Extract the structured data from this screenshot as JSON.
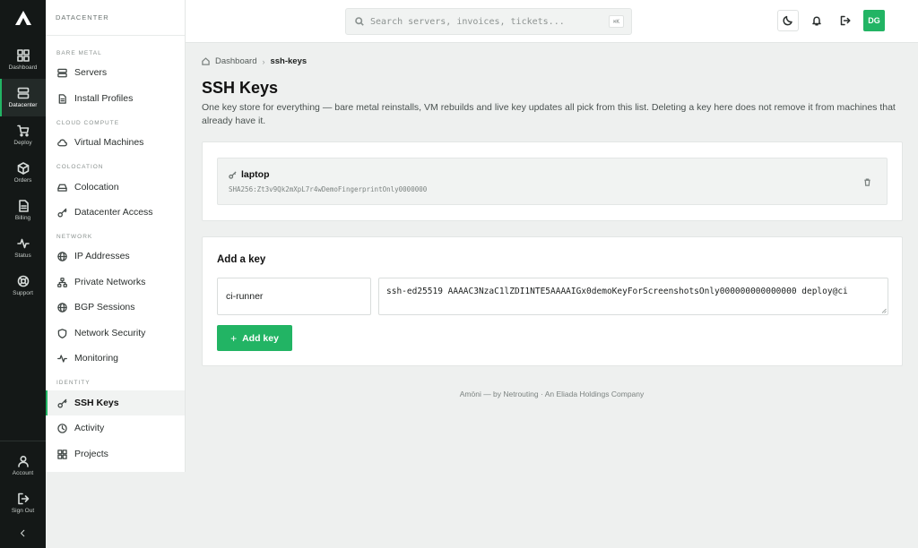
{
  "rail": {
    "items": [
      {
        "label": "Dashboard",
        "icon": "grid-icon"
      },
      {
        "label": "Datacenter",
        "icon": "server-icon",
        "active": true
      },
      {
        "label": "Deploy",
        "icon": "cart-icon"
      },
      {
        "label": "Orders",
        "icon": "box-icon"
      },
      {
        "label": "Billing",
        "icon": "document-icon"
      },
      {
        "label": "Status",
        "icon": "pulse-icon"
      },
      {
        "label": "Support",
        "icon": "lifebuoy-icon"
      }
    ],
    "bottom": [
      {
        "label": "Account",
        "icon": "user-icon"
      },
      {
        "label": "Sign Out",
        "icon": "logout-icon"
      }
    ],
    "collapse_icon": "chevron-left-icon"
  },
  "sidebar": {
    "header": "DATACENTER",
    "sections": {
      "bare_metal": "BARE METAL",
      "cloud_compute": "CLOUD COMPUTE",
      "colocation": "COLOCATION",
      "network": "NETWORK",
      "identity": "IDENTITY"
    },
    "items": {
      "servers": "Servers",
      "install_profiles": "Install Profiles",
      "virtual_machines": "Virtual Machines",
      "colocation": "Colocation",
      "datacenter_access": "Datacenter Access",
      "ip_addresses": "IP Addresses",
      "private_networks": "Private Networks",
      "bgp_sessions": "BGP Sessions",
      "network_security": "Network Security",
      "monitoring": "Monitoring",
      "ssh_keys": "SSH Keys",
      "activity": "Activity",
      "projects": "Projects"
    }
  },
  "topbar": {
    "search_placeholder": "Search servers, invoices, tickets...",
    "search_shortcut": "⌘K",
    "avatar_initials": "DG"
  },
  "breadcrumb": {
    "home": "Dashboard",
    "current": "ssh-keys"
  },
  "page": {
    "title": "SSH Keys",
    "description": "One key store for everything — bare metal reinstalls, VM rebuilds and live key updates all pick from this list. Deleting a key here does not remove it from machines that already have it."
  },
  "keys": [
    {
      "name": "laptop",
      "fingerprint": "SHA256:Zt3v9Qk2mXpL7r4wDemoFingerprintOnly0000000"
    }
  ],
  "add_key": {
    "title": "Add a key",
    "name_value": "ci-runner",
    "key_value": "ssh-ed25519 AAAAC3NzaC1lZDI1NTE5AAAAIGx0demoKeyForScreenshotsOnly000000000000000 deploy@ci",
    "button_label": "Add key"
  },
  "footer": "Amöni — by Netrouting · An Eliada Holdings Company",
  "colors": {
    "accent": "#22b464",
    "rail_bg": "#141817",
    "page_bg": "#eef0ef"
  }
}
